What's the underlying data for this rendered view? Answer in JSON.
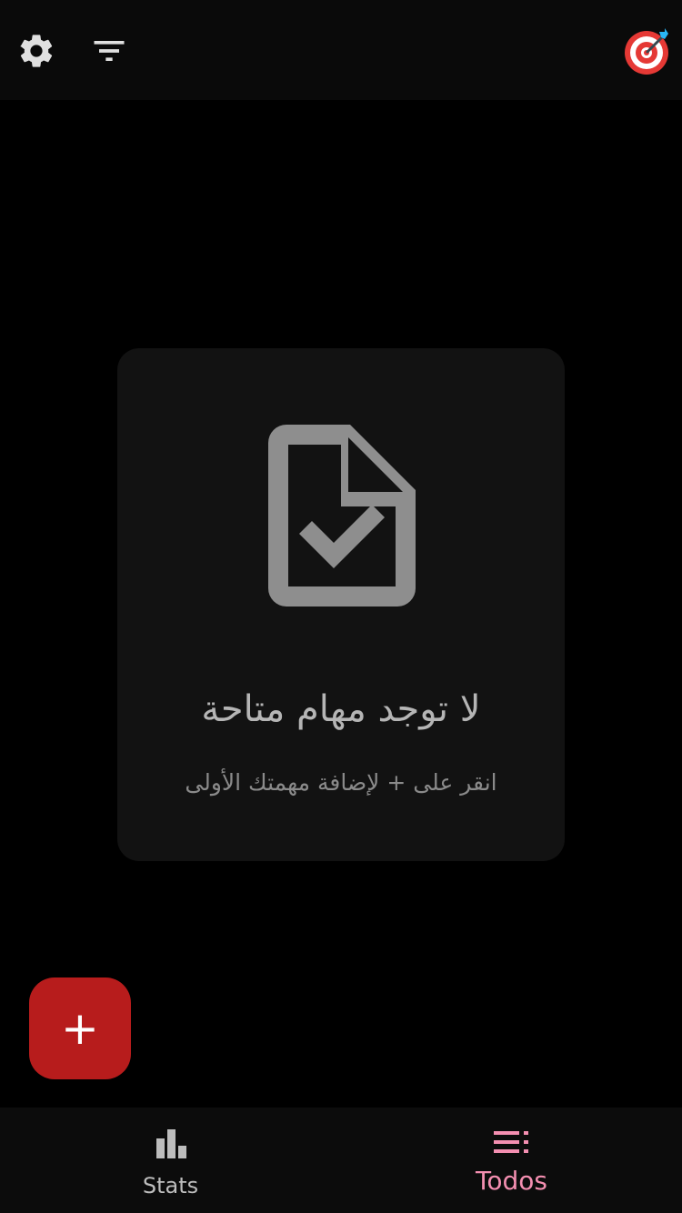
{
  "top_bar": {
    "settings_icon": "gear-icon",
    "filter_icon": "filter-icon",
    "target_icon": "target-icon"
  },
  "empty_state": {
    "icon": "file-check-icon",
    "title": "لا توجد مهام متاحة",
    "subtitle": "انقر على + لإضافة مهمتك الأولى"
  },
  "fab": {
    "label": "+"
  },
  "bottom_nav": {
    "items": [
      {
        "label": "Stats",
        "icon": "bar-chart-icon",
        "active": false
      },
      {
        "label": "Todos",
        "icon": "list-icon",
        "active": true
      }
    ]
  },
  "colors": {
    "background": "#000000",
    "card": "#121212",
    "fab": "#b71c1c",
    "active_nav": "#f48fb1",
    "inactive_nav": "#bdbdbd"
  }
}
